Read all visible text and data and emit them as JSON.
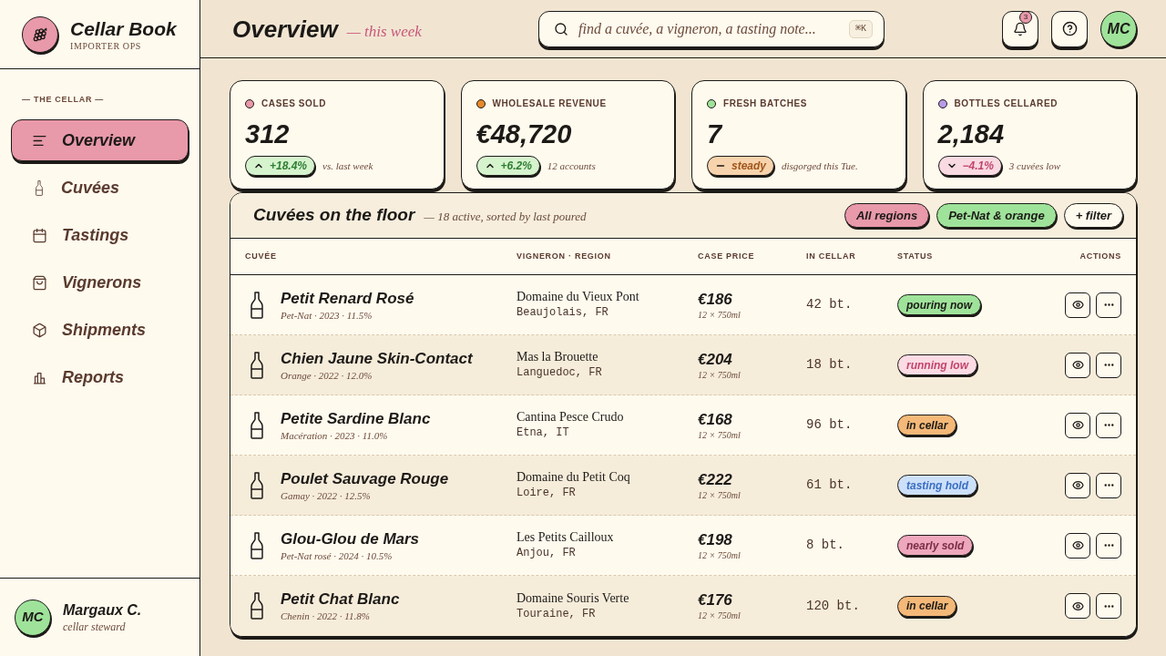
{
  "sidebar": {
    "brand": {
      "name": "Cellar Book",
      "tagline": "IMPORTER OPS"
    },
    "section_label": "— THE CELLAR —",
    "items": [
      {
        "label": "Overview",
        "selected": true
      },
      {
        "label": "Cuvées",
        "selected": false
      },
      {
        "label": "Tastings",
        "selected": false
      },
      {
        "label": "Vignerons",
        "selected": false
      },
      {
        "label": "Shipments",
        "selected": false
      },
      {
        "label": "Reports",
        "selected": false
      }
    ],
    "user": {
      "initials": "MC",
      "name": "Margaux C.",
      "role": "cellar steward"
    }
  },
  "header": {
    "title": "Overview",
    "subtitle": "— this week",
    "search": {
      "placeholder": "find a cuvée, a vigneron, a tasting note...",
      "shortcut": "⌘K"
    },
    "notifications": "3",
    "avatar": "MC"
  },
  "stats": [
    {
      "label": "CASES SOLD",
      "color": "#e899aa",
      "value": "312",
      "trend": {
        "kind": "up",
        "value": "+18.4%"
      },
      "note": "vs. last week"
    },
    {
      "label": "WHOLESALE REVENUE",
      "color": "#e5892b",
      "value": "€48,720",
      "trend": {
        "kind": "up",
        "value": "+6.2%"
      },
      "note": "12 accounts"
    },
    {
      "label": "FRESH BATCHES",
      "color": "#9fe39a",
      "value": "7",
      "trend": {
        "kind": "flat",
        "value": "steady"
      },
      "note": "disgorged this Tue."
    },
    {
      "label": "BOTTLES CELLARED",
      "color": "#b89be6",
      "value": "2,184",
      "trend": {
        "kind": "down",
        "value": "−4.1%"
      },
      "note": "3 cuvées low"
    }
  ],
  "table": {
    "title": "Cuvées on the floor",
    "subtitle": "— 18 active, sorted by last poured",
    "filters": [
      {
        "label": "All regions",
        "color": "#e899aa"
      },
      {
        "label": "Pet-Nat & orange",
        "color": "#9fe39a"
      }
    ],
    "add_filter": "+ filter",
    "columns": [
      "CUVÉE",
      "VIGNERON · REGION",
      "CASE PRICE",
      "IN CELLAR",
      "STATUS",
      "ACTIONS"
    ],
    "rows": [
      {
        "name": "Petit Renard Rosé",
        "details": "Pet-Nat · 2023 · 11.5%",
        "vigneron": "Domaine du Vieux Pont",
        "region": "Beaujolais, FR",
        "price": "€186",
        "pack": "12 × 750ml",
        "stock": "42 bt.",
        "status": {
          "label": "pouring now",
          "kind": "pouring"
        }
      },
      {
        "name": "Chien Jaune Skin-Contact",
        "details": "Orange · 2022 · 12.0%",
        "vigneron": "Mas la Brouette",
        "region": "Languedoc, FR",
        "price": "€204",
        "pack": "12 × 750ml",
        "stock": "18 bt.",
        "status": {
          "label": "running low",
          "kind": "low"
        }
      },
      {
        "name": "Petite Sardine Blanc",
        "details": "Macération · 2023 · 11.0%",
        "vigneron": "Cantina Pesce Crudo",
        "region": "Etna, IT",
        "price": "€168",
        "pack": "12 × 750ml",
        "stock": "96 bt.",
        "status": {
          "label": "in cellar",
          "kind": "cellar"
        }
      },
      {
        "name": "Poulet Sauvage Rouge",
        "details": "Gamay · 2022 · 12.5%",
        "vigneron": "Domaine du Petit Coq",
        "region": "Loire, FR",
        "price": "€222",
        "pack": "12 × 750ml",
        "stock": "61 bt.",
        "status": {
          "label": "tasting hold",
          "kind": "hold"
        }
      },
      {
        "name": "Glou-Glou de Mars",
        "details": "Pet-Nat rosé · 2024 · 10.5%",
        "vigneron": "Les Petits Cailloux",
        "region": "Anjou, FR",
        "price": "€198",
        "pack": "12 × 750ml",
        "stock": "8 bt.",
        "status": {
          "label": "nearly sold",
          "kind": "nearly"
        }
      },
      {
        "name": "Petit Chat Blanc",
        "details": "Chenin · 2022 · 11.8%",
        "vigneron": "Domaine Souris Verte",
        "region": "Touraine, FR",
        "price": "€176",
        "pack": "12 × 750ml",
        "stock": "120 bt.",
        "status": {
          "label": "in cellar",
          "kind": "cellar"
        }
      }
    ]
  }
}
